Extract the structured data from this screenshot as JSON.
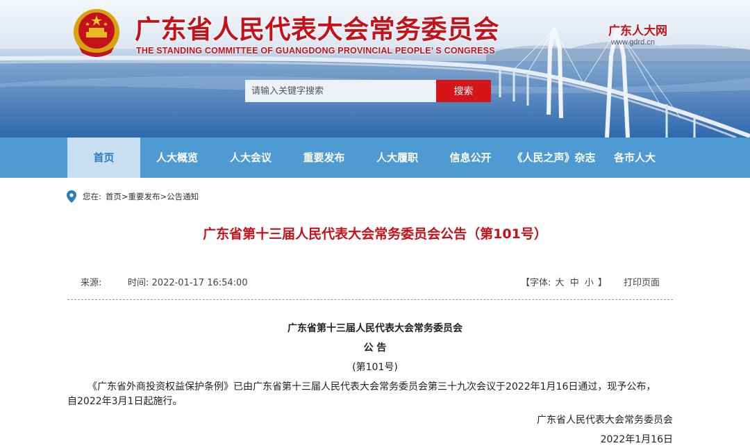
{
  "header": {
    "title": "广东省人民代表大会常务委员会",
    "subtitle": "THE STANDING COMMITTEE OF GUANGDONG PROVINCIAL PEOPLE’ S CONGRESS",
    "brand_name": "广东人大网",
    "brand_url": "www.gdrd.cn",
    "emblem_icon": "national-emblem-icon"
  },
  "search": {
    "placeholder": "请输入关键字搜索",
    "button_label": "搜索"
  },
  "nav": {
    "items": [
      {
        "label": "首页",
        "active": true
      },
      {
        "label": "人大概览"
      },
      {
        "label": "人大会议"
      },
      {
        "label": "重要发布"
      },
      {
        "label": "人大履职"
      },
      {
        "label": "信息公开"
      },
      {
        "label": "《人民之声》杂志"
      },
      {
        "label": "各市人大"
      }
    ]
  },
  "breadcrumb": {
    "prefix": "您在:",
    "items": [
      "首页",
      "重要发布",
      "公告通知"
    ],
    "separator": ">"
  },
  "article": {
    "title": "广东省第十三届人民代表大会常务委员会公告（第101号）",
    "meta": {
      "source_label": "来源:",
      "time_label": "时间:",
      "time_value": "2022-01-17 16:54:00",
      "font_label": "【字体:",
      "font_large": "大",
      "font_medium": "中",
      "font_small": "小",
      "font_close": "】",
      "print_label": "打印页面"
    },
    "body": {
      "issuer_heading": "广东省第十三届人民代表大会常务委员会",
      "notice_heading": "公 告",
      "number": "(第101号)",
      "paragraph_line1": "《广东省外商投资权益保护条例》已由广东省第十三届人民代表大会常务委员会第三十九次会议于2022年1月16日通过，现予公布，",
      "paragraph_line2": "自2022年3月1日起施行。",
      "signature": "广东省人民代表大会常务委员会",
      "date": "2022年1月16日"
    }
  },
  "colors": {
    "accent_red": "#c3121a",
    "search_red": "#d61518",
    "nav_blue": "#4e9ad3",
    "nav_active_bg": "#c7dff1",
    "divider_blue": "#6aa8dc"
  }
}
